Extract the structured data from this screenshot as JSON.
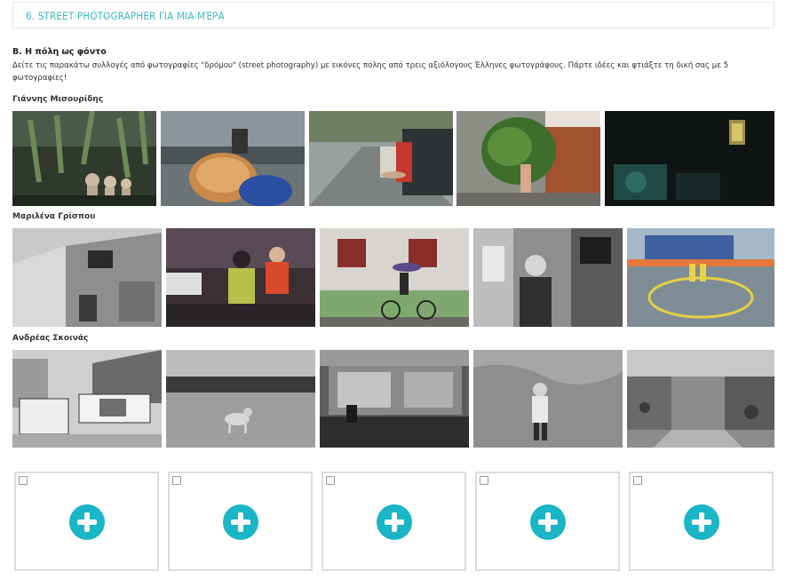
{
  "header": {
    "title": "6. Street photographer για μια μέρα"
  },
  "section": {
    "heading": "Β. Η πόλη ως φόντο",
    "description": "Δείτε τις παρακάτω συλλογές από φωτογραφίες \"δρόμου\" (street photography) με εικόνες πόλης από τρεις αξιόλογους Έλληνες φωτογράφους. Πάρτε ιδέες και φτιάξτε τη δική σας με 5 φωτογραφίες!"
  },
  "photographers": [
    {
      "name": "Γιάννης Μισουρίδης"
    },
    {
      "name": "Μαριλένα Γρίσπου"
    },
    {
      "name": "Ανδρέας Σκοινάς"
    }
  ],
  "uploads": {
    "count": 5,
    "icon": "plus-circle-icon",
    "accent": "#1ab5c6"
  },
  "colors": {
    "title": "#3bb6c4",
    "plus": "#1ab5c6"
  }
}
